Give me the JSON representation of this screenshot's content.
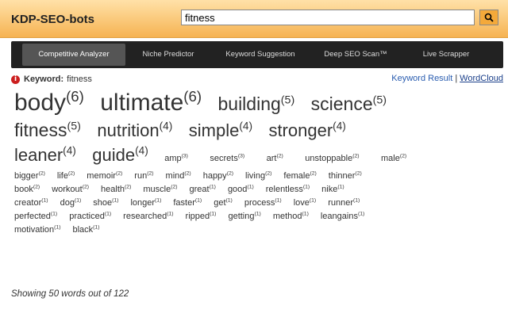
{
  "app": {
    "title": "KDP-SEO-bots"
  },
  "search": {
    "value": "fitness"
  },
  "nav": {
    "tabs": [
      {
        "label": "Competitive Analyzer",
        "active": true
      },
      {
        "label": "Niche Predictor",
        "active": false
      },
      {
        "label": "Keyword Suggestion",
        "active": false
      },
      {
        "label": "Deep SEO Scan™",
        "active": false
      },
      {
        "label": "Live Scrapper",
        "active": false
      }
    ]
  },
  "keyword": {
    "label": "Keyword:",
    "value": "fitness"
  },
  "links": {
    "result": "Keyword Result",
    "separator": "|",
    "cloud": "WordCloud"
  },
  "cloud": {
    "words": [
      {
        "text": "body",
        "count": "(6)"
      },
      {
        "text": "ultimate",
        "count": "(6)"
      },
      {
        "text": "building",
        "count": "(5)"
      },
      {
        "text": "science",
        "count": "(5)"
      },
      {
        "text": "fitness",
        "count": "(5)"
      },
      {
        "text": "nutrition",
        "count": "(4)"
      },
      {
        "text": "simple",
        "count": "(4)"
      },
      {
        "text": "stronger",
        "count": "(4)"
      },
      {
        "text": "leaner",
        "count": "(4)"
      },
      {
        "text": "guide",
        "count": "(4)"
      },
      {
        "text": "amp",
        "count": "(3)"
      },
      {
        "text": "secrets",
        "count": "(3)"
      },
      {
        "text": "art",
        "count": "(2)"
      },
      {
        "text": "unstoppable",
        "count": "(2)"
      },
      {
        "text": "male",
        "count": "(2)"
      },
      {
        "text": "bigger",
        "count": "(2)"
      },
      {
        "text": "life",
        "count": "(2)"
      },
      {
        "text": "memoir",
        "count": "(2)"
      },
      {
        "text": "run",
        "count": "(2)"
      },
      {
        "text": "mind",
        "count": "(2)"
      },
      {
        "text": "happy",
        "count": "(2)"
      },
      {
        "text": "living",
        "count": "(2)"
      },
      {
        "text": "female",
        "count": "(2)"
      },
      {
        "text": "thinner",
        "count": "(2)"
      },
      {
        "text": "book",
        "count": "(2)"
      },
      {
        "text": "workout",
        "count": "(2)"
      },
      {
        "text": "health",
        "count": "(2)"
      },
      {
        "text": "muscle",
        "count": "(2)"
      },
      {
        "text": "great",
        "count": "(1)"
      },
      {
        "text": "good",
        "count": "(1)"
      },
      {
        "text": "relentless",
        "count": "(1)"
      },
      {
        "text": "nike",
        "count": "(1)"
      },
      {
        "text": "creator",
        "count": "(1)"
      },
      {
        "text": "dog",
        "count": "(1)"
      },
      {
        "text": "shoe",
        "count": "(1)"
      },
      {
        "text": "longer",
        "count": "(1)"
      },
      {
        "text": "faster",
        "count": "(1)"
      },
      {
        "text": "get",
        "count": "(1)"
      },
      {
        "text": "process",
        "count": "(1)"
      },
      {
        "text": "love",
        "count": "(1)"
      },
      {
        "text": "runner",
        "count": "(1)"
      },
      {
        "text": "perfected",
        "count": "(1)"
      },
      {
        "text": "practiced",
        "count": "(1)"
      },
      {
        "text": "researched",
        "count": "(1)"
      },
      {
        "text": "ripped",
        "count": "(1)"
      },
      {
        "text": "getting",
        "count": "(1)"
      },
      {
        "text": "method",
        "count": "(1)"
      },
      {
        "text": "leangains",
        "count": "(1)"
      },
      {
        "text": "motivation",
        "count": "(1)"
      },
      {
        "text": "black",
        "count": "(1)"
      }
    ]
  },
  "footer": {
    "text": "Showing 50 words out of 122"
  },
  "colors": {
    "header_top": "#ffe1a8",
    "header_bottom": "#f6b352",
    "nav_bg": "#222222",
    "nav_active": "#555555",
    "link": "#2a5db0",
    "info_icon": "#cc1f1f"
  }
}
